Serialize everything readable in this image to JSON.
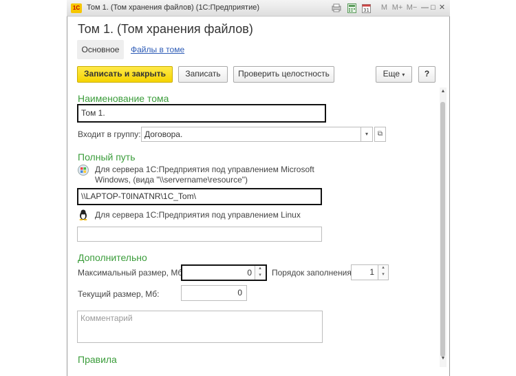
{
  "window": {
    "title": "Том 1. (Том хранения файлов)  (1С:Предприятие)",
    "app_logo": "1С",
    "controls": [
      "M",
      "M+",
      "M−",
      "—",
      "□",
      "✕"
    ]
  },
  "form": {
    "heading": "Том 1. (Том хранения файлов)",
    "tabs": [
      {
        "label": "Основное",
        "active": true
      },
      {
        "label": "Файлы в томе",
        "active": false
      }
    ]
  },
  "toolbar": {
    "save_close": "Записать и закрыть",
    "save": "Записать",
    "check": "Проверить целостность",
    "more": "Еще",
    "help": "?"
  },
  "name_section": {
    "title": "Наименование тома",
    "value": "Том 1.",
    "group_label": "Входит в группу:",
    "group_value": "Договора."
  },
  "path_section": {
    "title": "Полный путь",
    "windows_note_line1": "Для сервера 1С:Предприятия под управлением Microsoft",
    "windows_note_line2": "Windows, (вида \"\\\\servername\\resource\")",
    "windows_path": "\\\\LAPTOP-T0INATNR\\1C_Tom\\",
    "linux_note": "Для сервера 1С:Предприятия под управлением Linux",
    "linux_path": ""
  },
  "extra_section": {
    "title": "Дополнительно",
    "max_size_label": "Максимальный размер, Мб:",
    "max_size_value": "0",
    "order_label": "Порядок заполнения:",
    "order_value": "1",
    "current_size_label": "Текущий размер, Мб:",
    "current_size_value": "0",
    "comment_placeholder": "Комментарий"
  },
  "rules_section": {
    "title": "Правила"
  }
}
